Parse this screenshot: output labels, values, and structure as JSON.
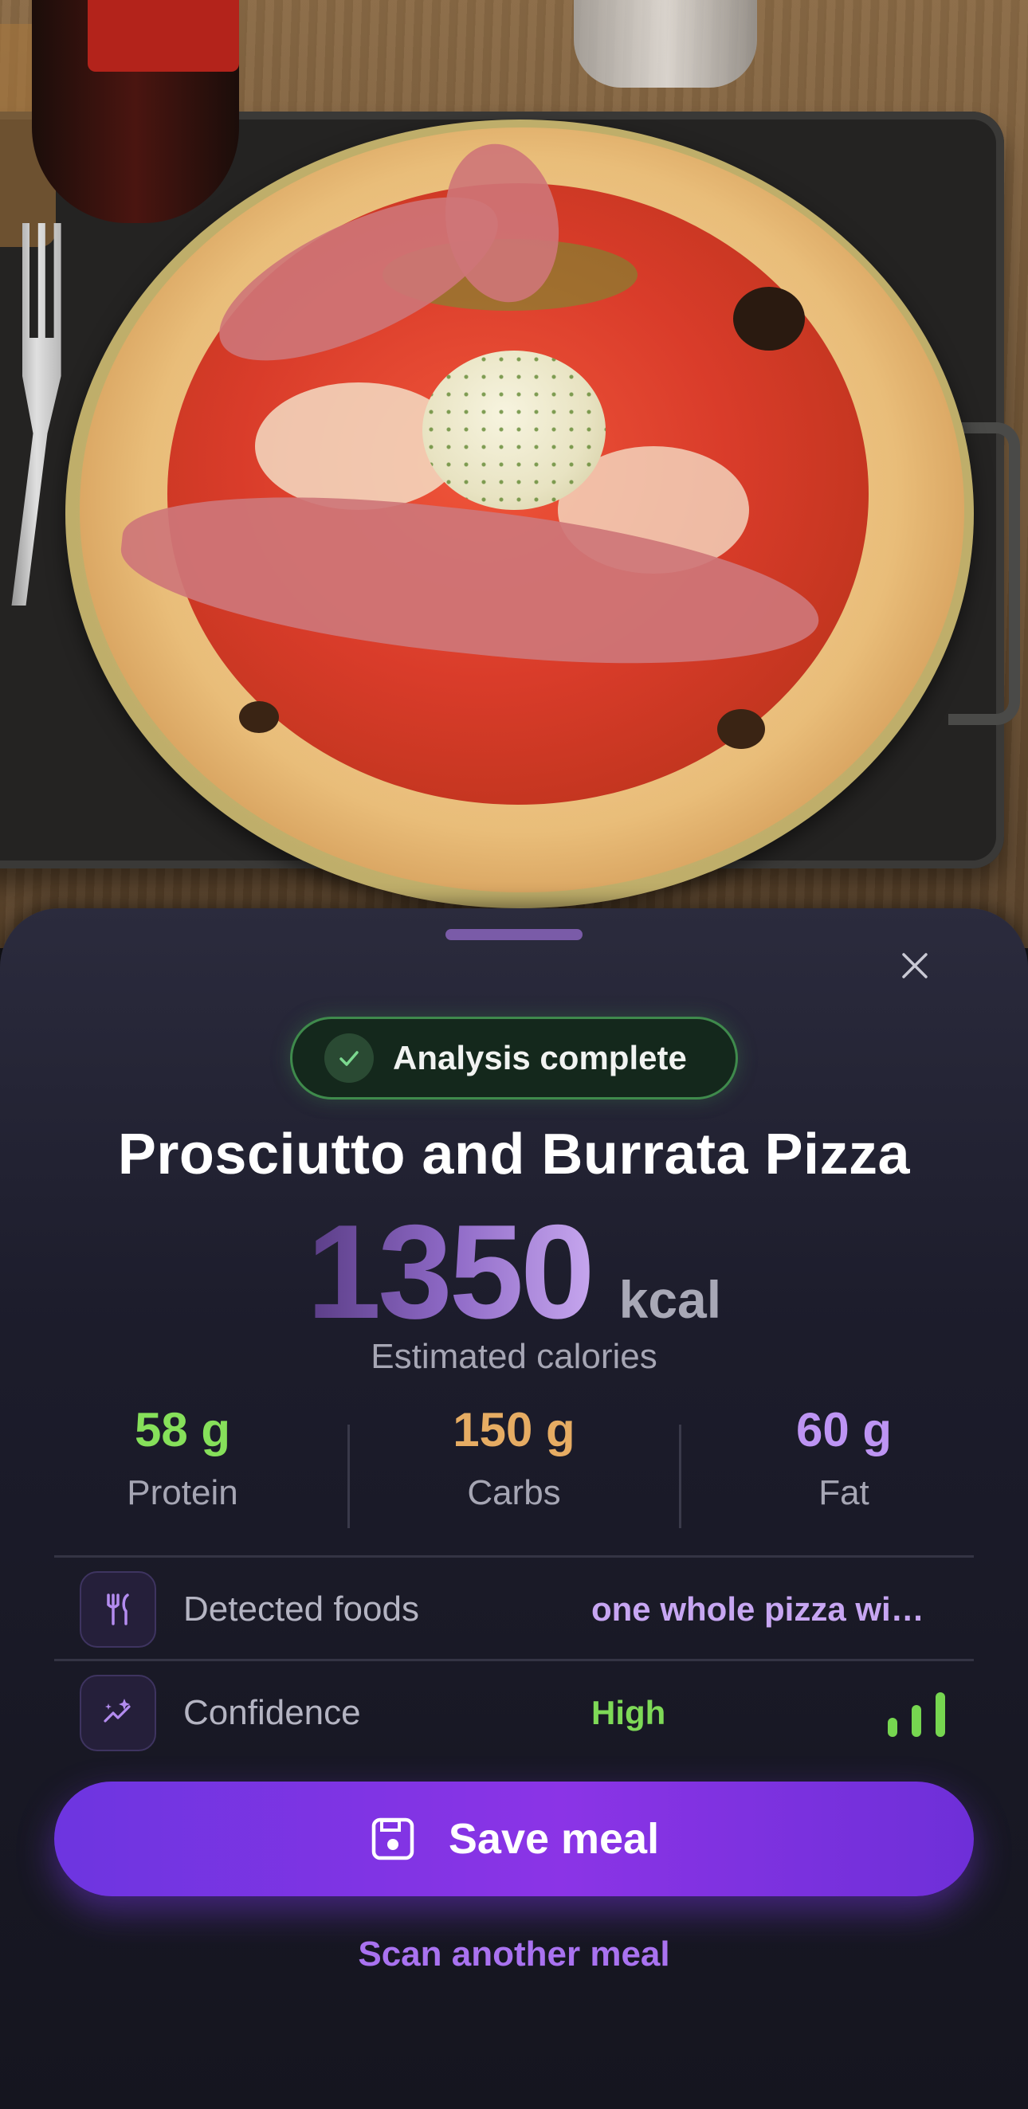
{
  "sheet": {
    "status": {
      "label": "Analysis complete",
      "icon": "check-icon"
    },
    "title": "Prosciutto and Burrata Pizza",
    "calories": {
      "value": "1350",
      "unit": "kcal",
      "caption": "Estimated calories"
    },
    "macros": [
      {
        "value": "58 g",
        "label": "Protein",
        "color": "#86e05a"
      },
      {
        "value": "150 g",
        "label": "Carbs",
        "color": "#e6ac63"
      },
      {
        "value": "60 g",
        "label": "Fat",
        "color": "#bd94f3"
      }
    ],
    "rows": {
      "foods": {
        "label": "Detected foods",
        "value": "one whole pizza wi…",
        "icon": "utensils-icon"
      },
      "confidence": {
        "label": "Confidence",
        "value": "High",
        "icon": "sparkle-chart-icon",
        "level": 3,
        "level_max": 3
      }
    },
    "save_button": {
      "label": "Save meal",
      "icon": "save-icon"
    },
    "scan_link": "Scan another meal",
    "close_icon": "close-icon",
    "colors": {
      "accent": "#7c3aed",
      "success": "#3f8a4c",
      "link": "#a972f0"
    }
  }
}
